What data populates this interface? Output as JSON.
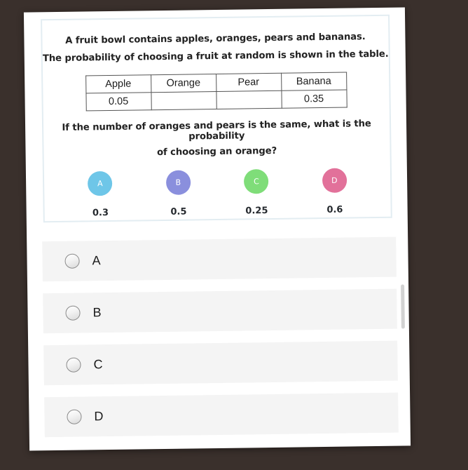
{
  "background_color": "#3a302c",
  "paper": {
    "background_color": "#ffffff"
  },
  "question_card": {
    "border_color": "#e3edf2",
    "stem_line_1": "A fruit bowl contains apples, oranges, pears and bananas.",
    "stem_line_2": "The probability of choosing a fruit at random is shown in the table.",
    "table": {
      "headers": [
        "Apple",
        "Orange",
        "Pear",
        "Banana"
      ],
      "values": [
        "0.05",
        "",
        "",
        "0.35"
      ]
    },
    "question_line_1": "If the number of oranges and pears is the same, what is the probability",
    "question_line_2": "of choosing an orange?",
    "choices": [
      {
        "letter": "A",
        "value": "0.3",
        "color": "#6ec6e8"
      },
      {
        "letter": "B",
        "value": "0.5",
        "color": "#8a8fdd"
      },
      {
        "letter": "C",
        "value": "0.25",
        "color": "#7fdd79"
      },
      {
        "letter": "D",
        "value": "0.6",
        "color": "#e2719a"
      }
    ]
  },
  "answer_options": [
    {
      "label": "A",
      "selected": false
    },
    {
      "label": "B",
      "selected": false
    },
    {
      "label": "C",
      "selected": false
    },
    {
      "label": "D",
      "selected": false
    }
  ],
  "scrollbar": {
    "thumb_color": "#d2d2d2"
  }
}
